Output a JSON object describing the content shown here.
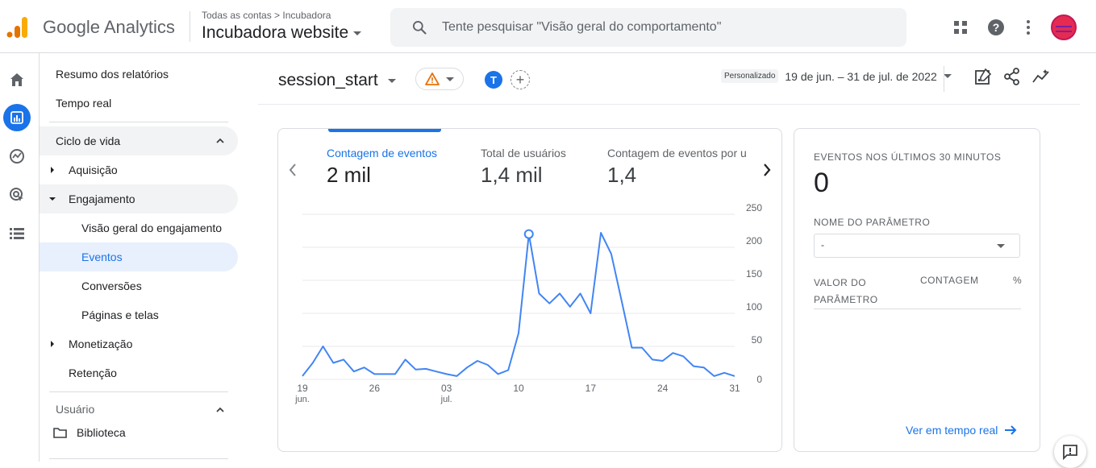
{
  "header": {
    "app_name": "Google Analytics",
    "breadcrumb": "Todas as contas > Incubadora",
    "property": "Incubadora website",
    "search_placeholder": "Tente pesquisar \"Visão geral do comportamento\""
  },
  "nav": {
    "summary": "Resumo dos relatórios",
    "realtime": "Tempo real",
    "lifecycle": "Ciclo de vida",
    "acquisition": "Aquisição",
    "engagement": "Engajamento",
    "engagement_overview": "Visão geral do engajamento",
    "events": "Eventos",
    "conversions": "Conversões",
    "pages": "Páginas e telas",
    "monetization": "Monetização",
    "retention": "Retenção",
    "user": "Usuário",
    "library": "Biblioteca"
  },
  "content": {
    "event_name": "session_start",
    "user_chip": "T",
    "date_badge": "Personalizado",
    "date_range": "19 de jun. – 31 de jul. de 2022"
  },
  "metrics": [
    {
      "label": "Contagem de eventos",
      "value": "2 mil"
    },
    {
      "label": "Total de usuários",
      "value": "1,4 mil"
    },
    {
      "label": "Contagem de eventos por u",
      "value": "1,4"
    }
  ],
  "chart_data": {
    "type": "line",
    "x_labels": [
      [
        "19",
        "jun."
      ],
      [
        "26",
        ""
      ],
      [
        "03",
        "jul."
      ],
      [
        "10",
        ""
      ],
      [
        "17",
        ""
      ],
      [
        "24",
        ""
      ],
      [
        "31",
        ""
      ]
    ],
    "y_ticks": [
      "250",
      "200",
      "150",
      "100",
      "50",
      "0"
    ],
    "ylim": [
      0,
      250
    ],
    "series": [
      {
        "values": [
          5,
          25,
          50,
          25,
          30,
          12,
          18,
          8,
          8,
          8,
          30,
          15,
          16,
          12,
          8,
          5,
          18,
          28,
          22,
          8,
          14,
          70,
          220,
          130,
          115,
          130,
          110,
          130,
          100,
          222,
          190,
          120,
          48,
          48,
          30,
          28,
          40,
          35,
          20,
          18,
          5,
          10,
          5
        ],
        "color": "#4285f4"
      }
    ]
  },
  "realtime": {
    "title": "EVENTOS NOS ÚLTIMOS 30 MINUTOS",
    "count": "0",
    "param_label": "NOME DO PARÂMETRO",
    "param_value": "-",
    "col_value_1": "VALOR DO",
    "col_value_2": "PARÂMETRO",
    "col_count": "CONTAGEM",
    "col_pct": "%",
    "link": "Ver em tempo real"
  },
  "colors": {
    "accent": "#1a73e8",
    "active_nav_bg": "#e8f0fe",
    "warning": "#e8710a"
  }
}
